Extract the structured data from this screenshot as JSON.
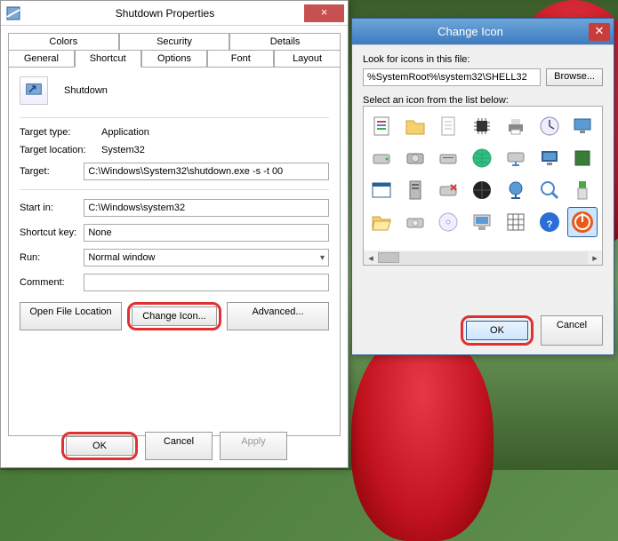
{
  "wallpaper": {
    "theme": "tulips-green"
  },
  "properties": {
    "title": "Shutdown Properties",
    "tabs_upper": [
      "Colors",
      "Security",
      "Details"
    ],
    "tabs_lower": [
      "General",
      "Shortcut",
      "Options",
      "Font",
      "Layout"
    ],
    "active_tab": "Shortcut",
    "header_name": "Shutdown",
    "fields": {
      "target_type_label": "Target type:",
      "target_type_value": "Application",
      "target_location_label": "Target location:",
      "target_location_value": "System32",
      "target_label": "Target:",
      "target_value": "C:\\Windows\\System32\\shutdown.exe -s -t 00",
      "start_in_label": "Start in:",
      "start_in_value": "C:\\Windows\\system32",
      "shortcut_key_label": "Shortcut key:",
      "shortcut_key_value": "None",
      "run_label": "Run:",
      "run_value": "Normal window",
      "comment_label": "Comment:",
      "comment_value": ""
    },
    "buttons": {
      "open_file_location": "Open File Location",
      "change_icon": "Change Icon...",
      "advanced": "Advanced..."
    },
    "footer": {
      "ok": "OK",
      "cancel": "Cancel",
      "apply": "Apply"
    }
  },
  "change_icon": {
    "title": "Change Icon",
    "look_label": "Look for icons in this file:",
    "look_value": "%SystemRoot%\\system32\\SHELL32",
    "browse": "Browse...",
    "select_label": "Select an icon from the list below:",
    "icons": [
      "document-icon",
      "folder-icon",
      "page-icon",
      "chip-icon",
      "printer-icon",
      "clock-icon",
      "desktop-icon",
      "drive-icon",
      "hdd-icon",
      "disc-drive-icon",
      "globe-icon",
      "network-drive-icon",
      "monitor-blue-icon",
      "green-square-icon",
      "window-icon",
      "server-icon",
      "drive-x-icon",
      "black-globe-icon",
      "network-globe-icon",
      "magnifier-icon",
      "usb-icon",
      "folder-open-icon",
      "optical-drive-icon",
      "cd-icon",
      "computer-icon",
      "grid-icon",
      "help-icon",
      "power-icon"
    ],
    "selected_icon": "power-icon",
    "footer": {
      "ok": "OK",
      "cancel": "Cancel"
    }
  }
}
